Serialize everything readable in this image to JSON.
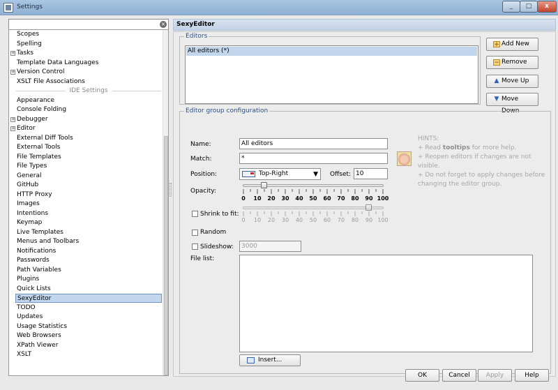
{
  "window": {
    "title": "Settings"
  },
  "sidebar": {
    "search_value": "",
    "items_top": [
      {
        "label": "Scopes",
        "expandable": false
      },
      {
        "label": "Spelling",
        "expandable": false
      },
      {
        "label": "Tasks",
        "expandable": true
      },
      {
        "label": "Template Data Languages",
        "expandable": false
      },
      {
        "label": "Version Control",
        "expandable": true
      },
      {
        "label": "XSLT File Associations",
        "expandable": false
      }
    ],
    "section_label": "IDE Settings",
    "items_ide": [
      {
        "label": "Appearance",
        "expandable": false
      },
      {
        "label": "Console Folding",
        "expandable": false
      },
      {
        "label": "Debugger",
        "expandable": true
      },
      {
        "label": "Editor",
        "expandable": true
      },
      {
        "label": "External Diff Tools",
        "expandable": false
      },
      {
        "label": "External Tools",
        "expandable": false
      },
      {
        "label": "File Templates",
        "expandable": false
      },
      {
        "label": "File Types",
        "expandable": false
      },
      {
        "label": "General",
        "expandable": false
      },
      {
        "label": "GitHub",
        "expandable": false
      },
      {
        "label": "HTTP Proxy",
        "expandable": false
      },
      {
        "label": "Images",
        "expandable": false
      },
      {
        "label": "Intentions",
        "expandable": false
      },
      {
        "label": "Keymap",
        "expandable": false
      },
      {
        "label": "Live Templates",
        "expandable": false
      },
      {
        "label": "Menus and Toolbars",
        "expandable": false
      },
      {
        "label": "Notifications",
        "expandable": false
      },
      {
        "label": "Passwords",
        "expandable": false
      },
      {
        "label": "Path Variables",
        "expandable": false
      },
      {
        "label": "Plugins",
        "expandable": false
      },
      {
        "label": "Quick Lists",
        "expandable": false
      },
      {
        "label": "SexyEditor",
        "expandable": false,
        "selected": true
      },
      {
        "label": "TODO",
        "expandable": false
      },
      {
        "label": "Updates",
        "expandable": false
      },
      {
        "label": "Usage Statistics",
        "expandable": false
      },
      {
        "label": "Web Browsers",
        "expandable": false
      },
      {
        "label": "XPath Viewer",
        "expandable": false
      },
      {
        "label": "XSLT",
        "expandable": false
      }
    ]
  },
  "panel": {
    "title": "SexyEditor",
    "editors_group_title": "Editors",
    "editors": [
      "All editors (*)"
    ],
    "buttons": {
      "add": "Add New",
      "remove": "Remove",
      "move_up": "Move Up",
      "move_down": "Move Down"
    },
    "config_group_title": "Editor group configuration",
    "name_label": "Name:",
    "name_value": "All editors",
    "match_label": "Match:",
    "match_value": "*",
    "position_label": "Position:",
    "position_value": "Top-Right",
    "offset_label": "Offset:",
    "offset_value": "10",
    "opacity_label": "Opacity:",
    "opacity_value": 15,
    "shrink_label": "Shrink to fit:",
    "shrink_checked": false,
    "shrink_value": 90,
    "random_label": "Random",
    "random_checked": false,
    "slideshow_label": "Slideshow:",
    "slideshow_checked": false,
    "slideshow_value": "3000",
    "file_list_label": "File list:",
    "insert_label": "Insert...",
    "tick_labels": [
      "0",
      "10",
      "20",
      "30",
      "40",
      "50",
      "60",
      "70",
      "80",
      "90",
      "100"
    ],
    "hints": {
      "title": "HINTS:",
      "line1_pre": "+ Read ",
      "line1_bold": "tooltips",
      "line1_post": " for more help.",
      "line2": "+ Reopen editors if changes are not visible.",
      "line3": "+ Do not forget to apply changes before changing the editor group."
    }
  },
  "footer": {
    "ok": "OK",
    "cancel": "Cancel",
    "apply": "Apply",
    "help": "Help"
  }
}
